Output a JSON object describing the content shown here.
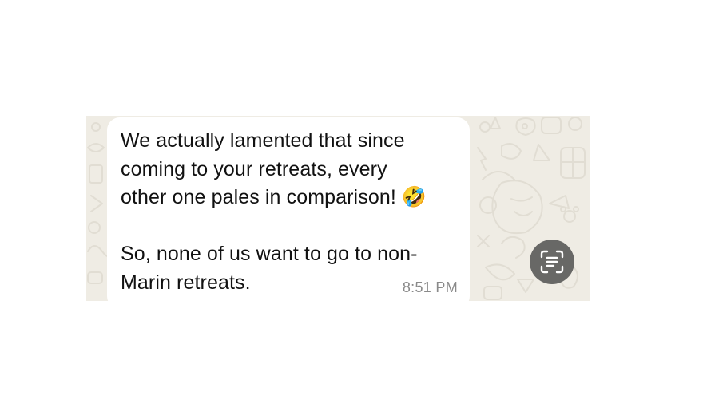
{
  "message": {
    "text": "We actually lamented that since\ncoming to your retreats, every\nother one pales in comparison! 🤣\n\nSo, none of us want to go to non-\nMarin retreats.",
    "time": "8:51 PM"
  },
  "icons": {
    "scan_text": "live-text-scan-icon",
    "wallpaper": "chat-wallpaper-doodles"
  },
  "colors": {
    "wallpaper": "#efece4",
    "bubble": "#ffffff",
    "timestamp": "#8a8a8a",
    "scan_button": "#686866"
  }
}
